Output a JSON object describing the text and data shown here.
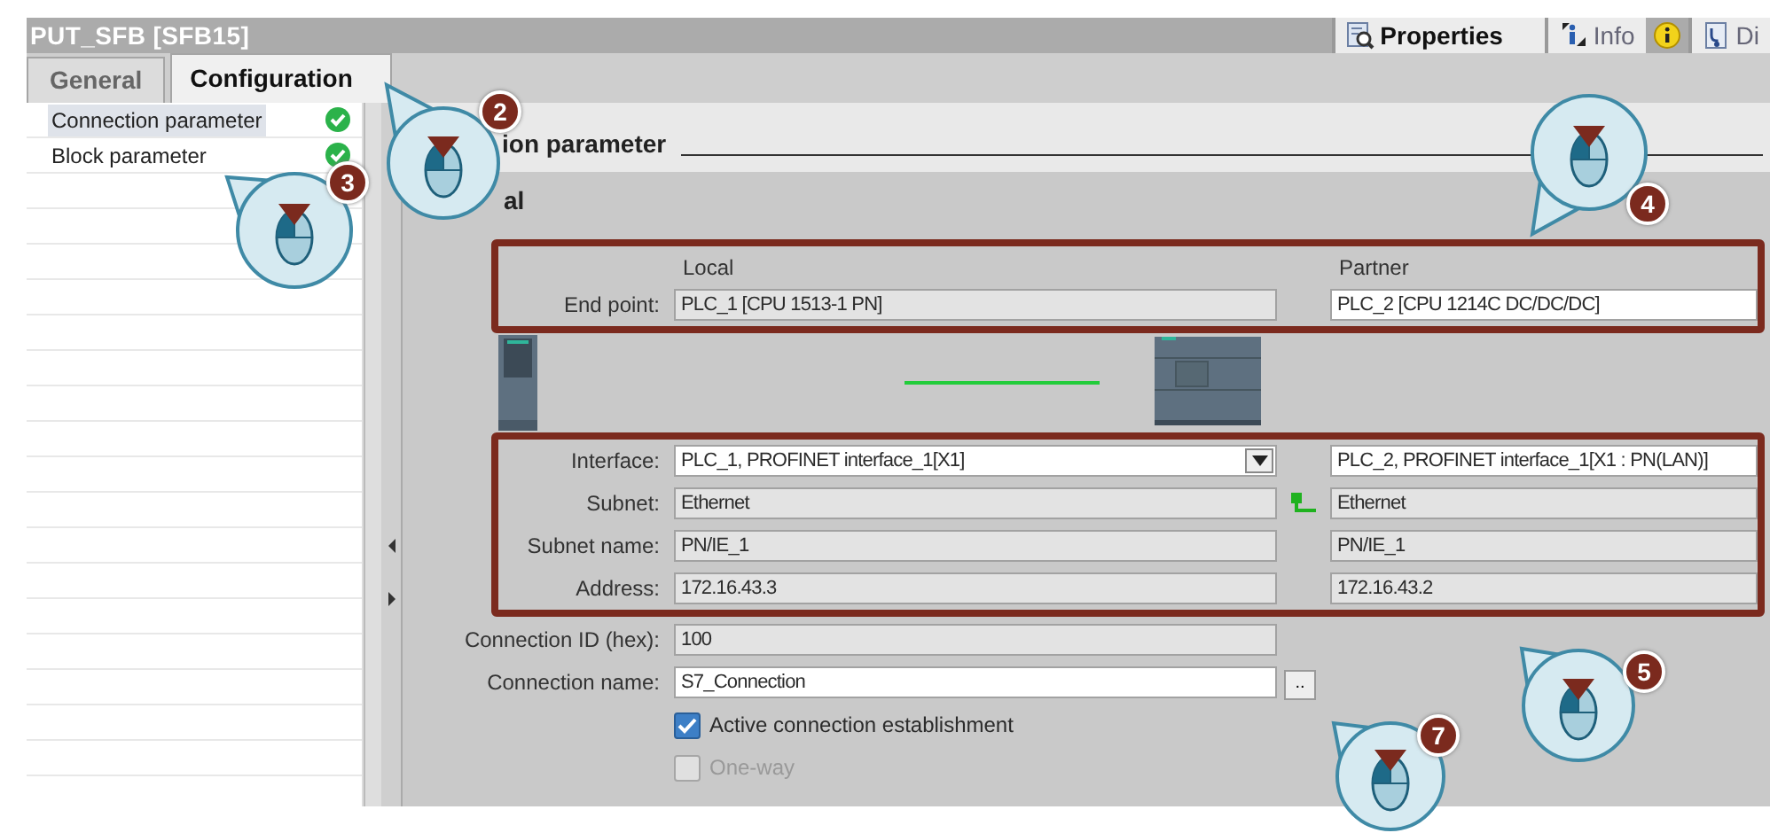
{
  "panel_title": "PUT_SFB [SFB15]",
  "inspector_tabs": [
    {
      "label": "Properties",
      "kind": "properties",
      "selected": true,
      "alert": false
    },
    {
      "label": "Info",
      "kind": "info",
      "selected": false,
      "alert": true
    },
    {
      "label": "Di",
      "kind": "diagnostics",
      "selected": false,
      "alert": false
    }
  ],
  "tabs": [
    {
      "label": "General",
      "selected": false
    },
    {
      "label": "Configuration",
      "selected": true
    }
  ],
  "nav_items": [
    {
      "label": "Connection parameter",
      "selected": true,
      "valid": true
    },
    {
      "label": "Block parameter",
      "selected": false,
      "valid": true
    }
  ],
  "section_heading": "ion parameter",
  "subsection_heading": "al",
  "columns": [
    "Local",
    "Partner"
  ],
  "endpoint": {
    "label": "End point:",
    "local": {
      "value": "PLC_1 [CPU 1513-1 PN]",
      "kind": "readonly"
    },
    "partner": {
      "value": "PLC_2 [CPU 1214C DC/DC/DC]",
      "kind": "editable"
    }
  },
  "interface_rows": [
    {
      "label": "Interface:",
      "linked": false,
      "local": {
        "value": "PLC_1, PROFINET interface_1[X1]",
        "kind": "dropdown"
      },
      "partner": {
        "value": "PLC_2, PROFINET interface_1[X1 : PN(LAN)]",
        "kind": "editable"
      }
    },
    {
      "label": "Subnet:",
      "linked": true,
      "local": {
        "value": "Ethernet",
        "kind": "readonly"
      },
      "partner": {
        "value": "Ethernet",
        "kind": "readonly"
      }
    },
    {
      "label": "Subnet name:",
      "linked": false,
      "local": {
        "value": "PN/IE_1",
        "kind": "readonly"
      },
      "partner": {
        "value": "PN/IE_1",
        "kind": "readonly"
      }
    },
    {
      "label": "Address:",
      "linked": false,
      "local": {
        "value": "172.16.43.3",
        "kind": "readonly"
      },
      "partner": {
        "value": "172.16.43.2",
        "kind": "readonly"
      }
    }
  ],
  "connection_rows": [
    {
      "label": "Connection ID (hex):",
      "value": "100",
      "kind": "readonly"
    },
    {
      "label": "Connection name:",
      "value": "S7_Connection",
      "kind": "editable",
      "button": ".."
    }
  ],
  "options": [
    {
      "label": "Active connection establishment",
      "checked": true,
      "disabled": false
    },
    {
      "label": "One-way",
      "checked": false,
      "disabled": true
    }
  ],
  "callouts": [
    {
      "number": "2"
    },
    {
      "number": "3"
    },
    {
      "number": "4"
    },
    {
      "number": "5"
    },
    {
      "number": "7"
    }
  ]
}
